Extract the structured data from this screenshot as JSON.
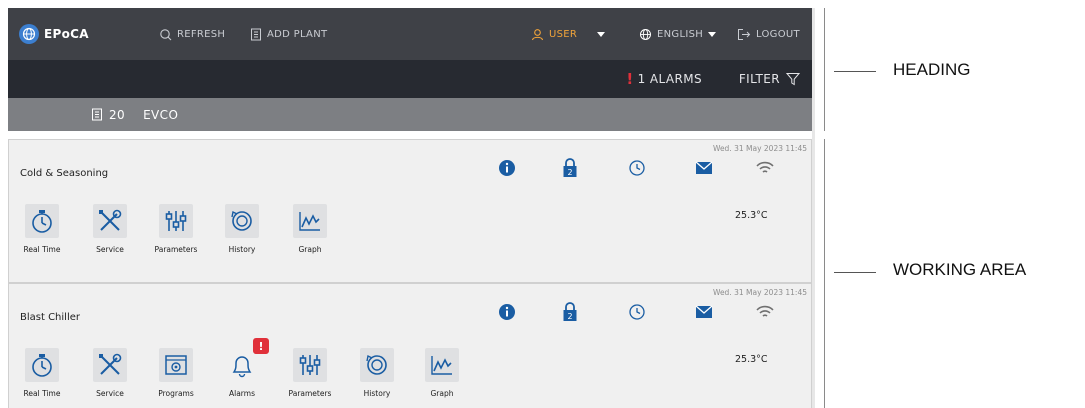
{
  "topbar": {
    "brand": "EPoCA",
    "refresh_label": "REFRESH",
    "add_plant_label": "ADD PLANT",
    "user_label": "USER",
    "language_label": "ENGLISH",
    "logout_label": "LOGOUT"
  },
  "statusbar": {
    "alarms_label": "1 ALARMS",
    "filter_label": "FILTER"
  },
  "sitebar": {
    "count": "20",
    "name": "EVCO"
  },
  "panels": [
    {
      "name": "Cold & Seasoning",
      "date": "Wed. 31 May 2023 11:45",
      "temperature": "25.3°C",
      "tiles": [
        "Real Time",
        "Service",
        "Parameters",
        "History",
        "Graph"
      ]
    },
    {
      "name": "Blast Chiller",
      "date": "Wed. 31 May 2023 11:45",
      "temperature": "25.3°C",
      "tiles": [
        "Real Time",
        "Service",
        "Programs",
        "Alarms",
        "Parameters",
        "History",
        "Graph"
      ],
      "alarm_badge": "!"
    }
  ],
  "annotations": {
    "heading": "HEADING",
    "working_area": "WORKING AREA"
  },
  "colors": {
    "topbar_bg": "#3f4147",
    "alarmbar_bg": "#272a31",
    "sitebar_bg": "#7d7f83",
    "accent_blue": "#1a5da3",
    "user_orange": "#f0a33a",
    "alarm_red": "#e0303a"
  }
}
